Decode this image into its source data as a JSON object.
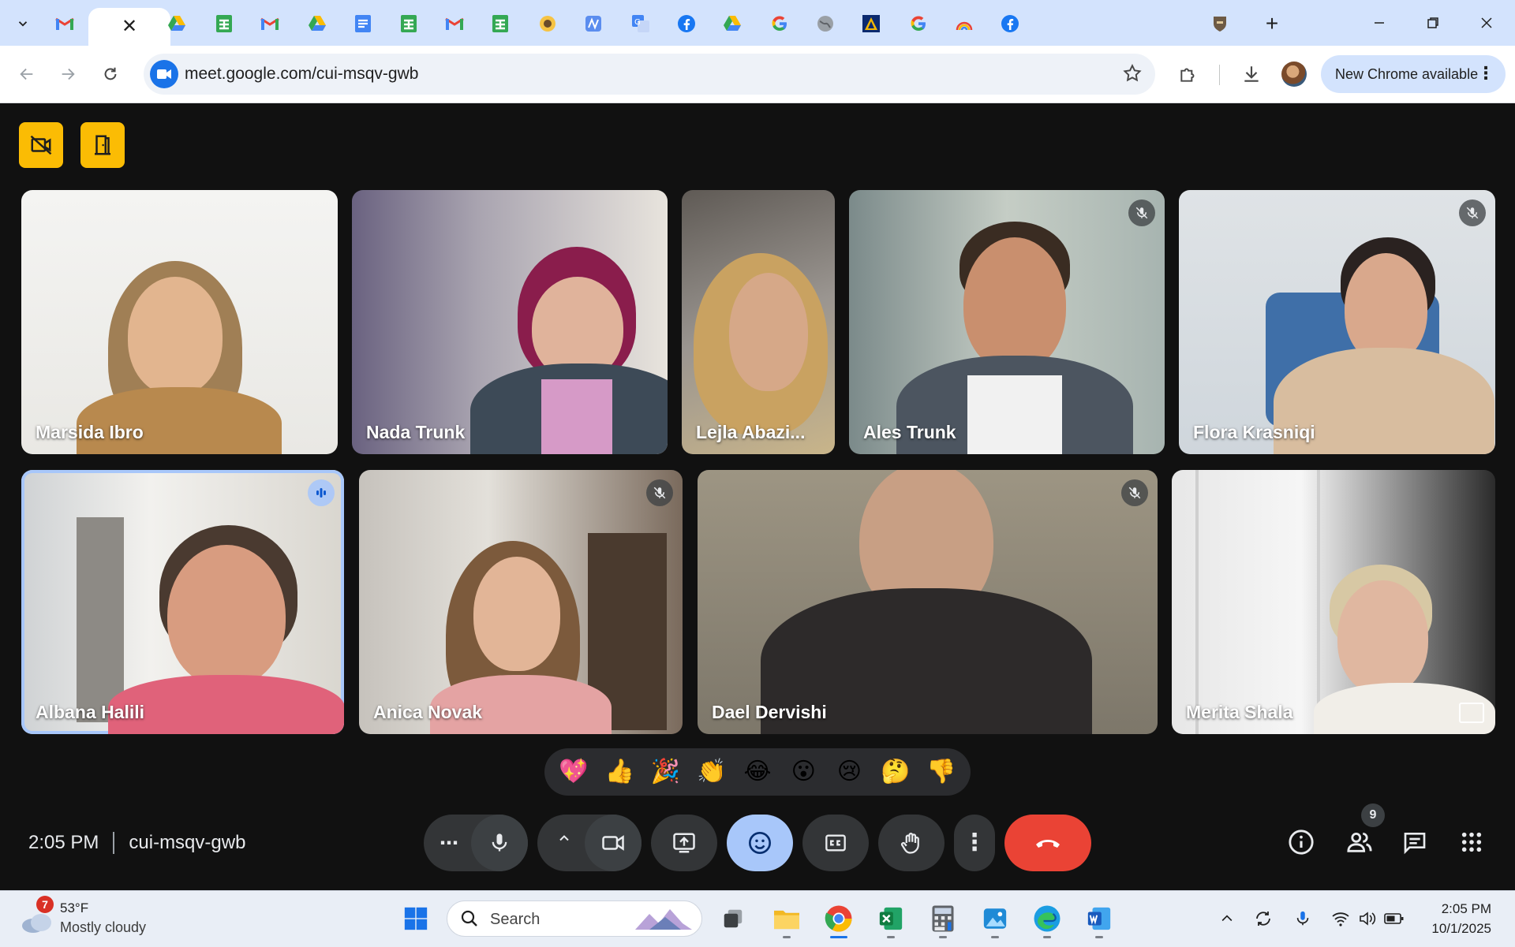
{
  "browser": {
    "url": "meet.google.com/cui-msqv-gwb",
    "tabs": [
      {
        "icon": "gmail-icon"
      },
      {
        "icon": "close-icon",
        "active": true
      },
      {
        "icon": "google-drive-icon"
      },
      {
        "icon": "google-sheets-icon"
      },
      {
        "icon": "gmail-icon"
      },
      {
        "icon": "google-drive-icon"
      },
      {
        "icon": "google-docs-icon"
      },
      {
        "icon": "google-sheets-icon"
      },
      {
        "icon": "gmail-icon"
      },
      {
        "icon": "google-sheets-icon"
      },
      {
        "icon": "site-icon"
      },
      {
        "icon": "site-icon"
      },
      {
        "icon": "google-translate-icon"
      },
      {
        "icon": "facebook-icon"
      },
      {
        "icon": "google-drive-icon"
      },
      {
        "icon": "google-icon"
      },
      {
        "icon": "globe-icon"
      },
      {
        "icon": "site-icon"
      },
      {
        "icon": "google-icon"
      },
      {
        "icon": "site-icon"
      },
      {
        "icon": "facebook-icon"
      },
      {
        "icon": "site-icon"
      }
    ],
    "new_chrome_label": "New Chrome available"
  },
  "meet": {
    "participants": [
      {
        "name": "Marsida Ibro",
        "muted": false
      },
      {
        "name": "Nada Trunk",
        "muted": false
      },
      {
        "name": "Lejla Abazi...",
        "muted": false
      },
      {
        "name": "Ales Trunk",
        "muted": true
      },
      {
        "name": "Flora Krasniqi",
        "muted": true
      },
      {
        "name": "Albana Halili",
        "speaking": true
      },
      {
        "name": "Anica Novak",
        "muted": true
      },
      {
        "name": "Dael Dervishi",
        "muted": true
      },
      {
        "name": "Merita Shala",
        "muted": false
      }
    ],
    "reactions": [
      "💖",
      "👍",
      "🎉",
      "👏",
      "😂",
      "😮",
      "😢",
      "🤔",
      "👎"
    ],
    "time": "2:05 PM",
    "meeting_code": "cui-msqv-gwb",
    "people_count": "9"
  },
  "taskbar": {
    "weather_badge": "7",
    "temperature": "53°F",
    "condition": "Mostly cloudy",
    "search_label": "Search",
    "clock_time": "2:05 PM",
    "clock_date": "10/1/2025"
  },
  "colors": {
    "tabstrip": "#d3e3fd",
    "meet_bg": "#111111",
    "reaction_active": "#a8c7fa",
    "end_call": "#ea4335",
    "host_button": "#fbbc04"
  }
}
